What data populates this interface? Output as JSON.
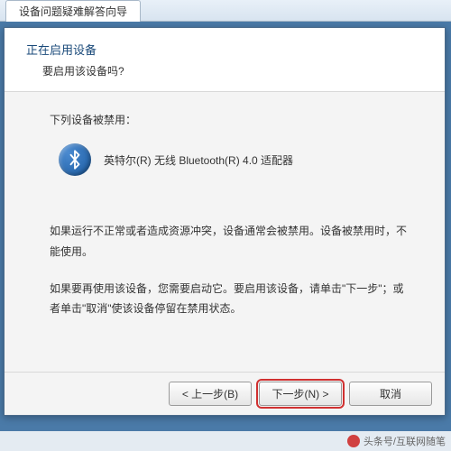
{
  "tab": {
    "title": "设备问题疑难解答向导"
  },
  "header": {
    "title": "正在启用设备",
    "subtitle": "要启用该设备吗?"
  },
  "content": {
    "disabled_label": "下列设备被禁用：",
    "device_name": "英特尔(R) 无线 Bluetooth(R) 4.0 适配器",
    "para1": "如果运行不正常或者造成资源冲突，设备通常会被禁用。设备被禁用时，不能使用。",
    "para2": "如果要再使用该设备，您需要启动它。要启用该设备，请单击\"下一步\"；或者单击\"取消\"使该设备停留在禁用状态。"
  },
  "buttons": {
    "back": "< 上一步(B)",
    "next": "下一步(N) >",
    "cancel": "取消"
  },
  "footer": {
    "text": "头条号/互联网随笔"
  }
}
